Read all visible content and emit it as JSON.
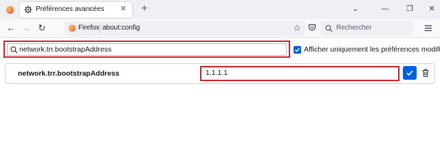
{
  "tab": {
    "title": "Préférences avancées",
    "close_glyph": "✕"
  },
  "toolbar": {
    "new_tab_glyph": "+",
    "back_glyph": "←",
    "forward_glyph": "→",
    "reload_glyph": "↻",
    "bookmark_glyph": "☆"
  },
  "window_controls": {
    "list_glyph": "⌄",
    "minimize_glyph": "—",
    "restore_glyph": "❐",
    "close_glyph": "✕"
  },
  "urlbar": {
    "identity": "Firefox",
    "url": "about:config"
  },
  "searchbar": {
    "placeholder": "Rechercher"
  },
  "config": {
    "search_value": "network.trr.bootstrapAddress",
    "show_modified_only_label": "Afficher uniquement les préférences modifiées",
    "show_modified_only_checked": true,
    "pref": {
      "name": "network.trr.bootstrapAddress",
      "value": "1.1.1.1"
    }
  },
  "colors": {
    "accent": "#0061e0",
    "highlight": "#d0202a"
  }
}
